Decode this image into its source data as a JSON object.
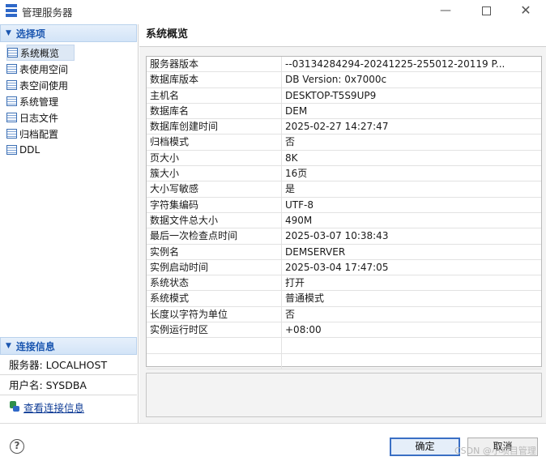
{
  "window": {
    "title": "管理服务器",
    "minimize_glyph": "—",
    "close_glyph": "✕"
  },
  "left": {
    "section_title": "选择项",
    "items": [
      {
        "label": "系统概览",
        "selected": true
      },
      {
        "label": "表使用空间"
      },
      {
        "label": "表空间使用"
      },
      {
        "label": "系统管理"
      },
      {
        "label": "日志文件"
      },
      {
        "label": "归档配置"
      },
      {
        "label": "DDL"
      }
    ],
    "connection": {
      "title": "连接信息",
      "server_line": "服务器: LOCALHOST",
      "user_line": "用户名: SYSDBA",
      "link_text": "查看连接信息"
    }
  },
  "right": {
    "title": "系统概览",
    "rows": [
      {
        "key": "服务器版本",
        "value": "--03134284294-20241225-255012-20119 P..."
      },
      {
        "key": "数据库版本",
        "value": "DB Version: 0x7000c"
      },
      {
        "key": "主机名",
        "value": "DESKTOP-T5S9UP9"
      },
      {
        "key": "数据库名",
        "value": "DEM"
      },
      {
        "key": "数据库创建时间",
        "value": "2025-02-27 14:27:47"
      },
      {
        "key": "归档模式",
        "value": "否"
      },
      {
        "key": "页大小",
        "value": "8K"
      },
      {
        "key": "簇大小",
        "value": "16页"
      },
      {
        "key": "大小写敏感",
        "value": "是"
      },
      {
        "key": "字符集编码",
        "value": "UTF-8"
      },
      {
        "key": "数据文件总大小",
        "value": "490M"
      },
      {
        "key": "最后一次检查点时间",
        "value": "2025-03-07 10:38:43"
      },
      {
        "key": "实例名",
        "value": "DEMSERVER"
      },
      {
        "key": "实例启动时间",
        "value": "2025-03-04 17:47:05"
      },
      {
        "key": "系统状态",
        "value": "打开"
      },
      {
        "key": "系统模式",
        "value": "普通模式"
      },
      {
        "key": "长度以字符为单位",
        "value": "否"
      },
      {
        "key": "实例运行时区",
        "value": "+08:00"
      },
      {
        "key": "",
        "value": ""
      },
      {
        "key": "",
        "value": ""
      }
    ]
  },
  "footer": {
    "help_glyph": "?",
    "ok_label": "确定",
    "cancel_label": "取消",
    "watermark": "CSDN @小项目管理"
  }
}
